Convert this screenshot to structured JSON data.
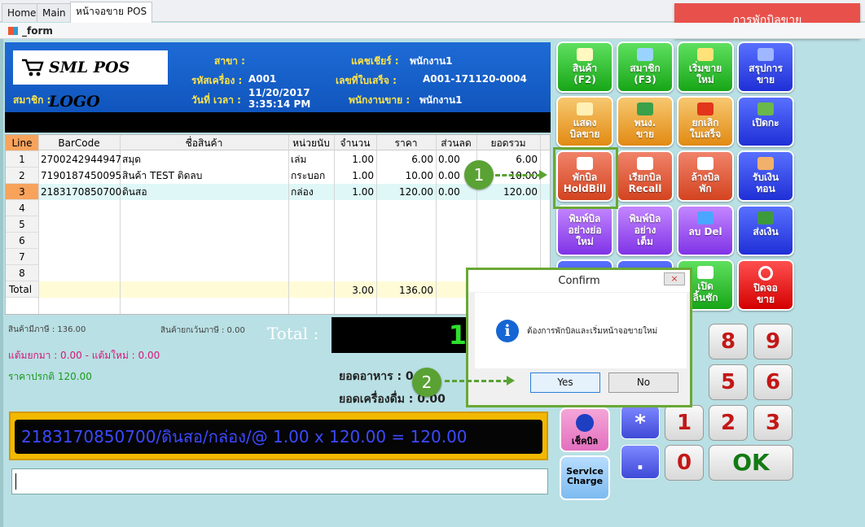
{
  "tabs": [
    {
      "label": "Home"
    },
    {
      "label": "Main"
    },
    {
      "label": "หน้าจอขาย POS"
    }
  ],
  "form_title": "_form",
  "hold_banner": "การพักบิลขาย",
  "header": {
    "logo": "SML POS LOGO",
    "branch_label": "สาขา :",
    "cashier_label": "แคชเชียร์ :",
    "cashier_value": "พนักงาน1",
    "machine_label": "รหัสเครื่อง :",
    "machine_value": "A001",
    "receipt_label": "เลขที่ใบเสร็จ :",
    "receipt_value": "A001-171120-0004",
    "datetime_label": "วันที่ เวลา :",
    "date_value": "11/20/2017",
    "time_value": "3:35:14 PM",
    "member_label": "สมาชิก :",
    "seller_label": "พนักงานขาย :",
    "seller_value": "พนักงาน1"
  },
  "grid": {
    "columns": [
      "Line",
      "BarCode",
      "ชื่อสินค้า",
      "หน่วยนับ",
      "จำนวน",
      "ราคา",
      "ส่วนลด",
      "ยอดรวม"
    ],
    "rows": [
      {
        "line": "1",
        "barcode": "2700242944947",
        "name": "สมุด",
        "unit": "เล่ม",
        "qty": "1.00",
        "price": "6.00",
        "disc": "0.00",
        "total": "6.00"
      },
      {
        "line": "2",
        "barcode": "7190187450095",
        "name": "สินค้า TEST ติดลบ",
        "unit": "กระบอก",
        "qty": "1.00",
        "price": "10.00",
        "disc": "0.00",
        "total": "10.00"
      },
      {
        "line": "3",
        "barcode": "2183170850700",
        "name": "ดินสอ",
        "unit": "กล่อง",
        "qty": "1.00",
        "price": "120.00",
        "disc": "0.00",
        "total": "120.00"
      }
    ],
    "empty_lines": [
      "4",
      "5",
      "6",
      "7",
      "8"
    ],
    "total_label": "Total",
    "total_qty": "3.00",
    "total_price": "136.00"
  },
  "summary": {
    "taxable": "สินค้ามีภาษี : 136.00",
    "exempt": "สินค้ายกเว้นภาษี : 0.00",
    "points": "แต้มยกมา : 0.00 - แต้มใหม่ : 0.00",
    "normal_price": "ราคาปรกติ 120.00",
    "total_label": "Total :",
    "total_value": "1",
    "food_label": "ยอดอาหาร : 0",
    "drink_label": "ยอดเครื่องดื่ม : 0.00"
  },
  "display_line": "2183170850700/ดินสอ/กล่อง/@ 1.00 x 120.00 = 120.00",
  "buttons": {
    "product": "สินค้า\n(F2)",
    "member": "สมาชิก\n(F3)",
    "new_sale": "เริ่มขาย\nใหม่",
    "summary": "สรุปการ\nขาย",
    "show_bill": "แสดง\nบิลขาย",
    "staff": "พนง.\nขาย",
    "cancel_receipt": "ยกเลิก\nใบเสร็จ",
    "open_drawer": "เปิดกะ",
    "hold": "พักบิล\nHoldBill",
    "recall": "เรียกบิล\nRecall",
    "clear_hold": "ล้างบิล\nพัก",
    "receive": "รับเงิน\nทอน",
    "print_short": "พิมพ์บิล\nอย่างย่อ\nใหม่",
    "print_full": "พิมพ์บิล\nอย่าง\nเต็ม",
    "delete": "ลบ Del",
    "send_money": "ส่งเงิน",
    "open_bill": "เปิด\nลิ้นชัก",
    "close_screen": "ปิดจอ\nขาย",
    "check_bill": "เช็คบิล",
    "service_charge": "Service\nCharge"
  },
  "keypad": {
    "k8": "8",
    "k9": "9",
    "k5": "5",
    "k6": "6",
    "k1": "1",
    "k2": "2",
    "k3": "3",
    "k0": "0",
    "ok": "OK",
    "star": "*",
    "dot": "."
  },
  "dialog": {
    "title": "Confirm",
    "message": "ต้องการพักบิลและเริ่มหน้าจอขายใหม่",
    "yes": "Yes",
    "no": "No",
    "close": "×"
  },
  "markers": {
    "m1": "1",
    "m2": "2"
  },
  "colors": {
    "accent": "#5aa234",
    "banner": "#e8514b",
    "header": "#1e6bd6"
  }
}
